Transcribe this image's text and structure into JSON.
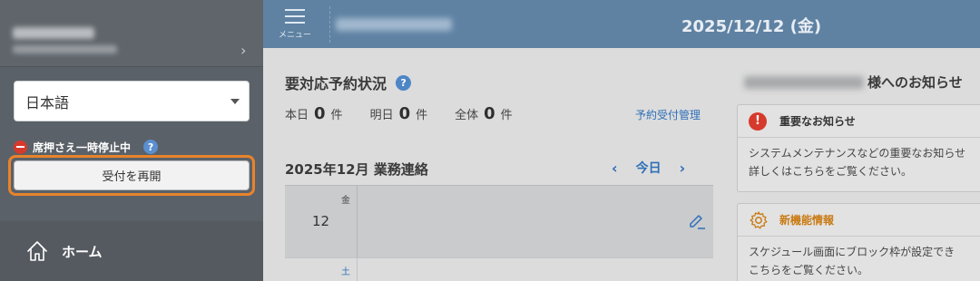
{
  "sidebar": {
    "account_chevron": "›",
    "language": {
      "selected": "日本語"
    },
    "pause_status": "席押さえ一時停止中",
    "help_glyph": "?",
    "resume_button": "受付を再開",
    "nav": {
      "home": "ホーム"
    }
  },
  "header": {
    "menu_label": "メニュー",
    "date": "2025/12/12 (金)"
  },
  "reservation": {
    "title": "要対応予約状況",
    "help_glyph": "?",
    "counts": [
      {
        "label": "本日",
        "value": "0",
        "unit": "件"
      },
      {
        "label": "明日",
        "value": "0",
        "unit": "件"
      },
      {
        "label": "全体",
        "value": "0",
        "unit": "件"
      }
    ],
    "manage_link": "予約受付管理"
  },
  "contact": {
    "title": "2025年12月 業務連絡",
    "prev": "‹",
    "today": "今日",
    "next": "›",
    "rows": [
      {
        "weekday": "金",
        "day": "12"
      },
      {
        "weekday": "土",
        "day": ""
      }
    ]
  },
  "notices": {
    "title_suffix": "様へのお知らせ",
    "important": {
      "icon": "!",
      "title": "重要なお知らせ",
      "body_line1": "システムメンテナンスなどの重要なお知らせ",
      "body_line2": "詳しくはこちらをご覧ください。"
    },
    "new_features": {
      "title": "新機能情報",
      "body_line1": "スケジュール画面にブロック枠が設定でき",
      "body_line2": "こちらをご覧ください。"
    }
  },
  "colors": {
    "sidebar_bg": "#5b6168",
    "header_bg": "#5f82a3",
    "accent_orange": "#e8832b",
    "link_blue": "#2e6fb8",
    "alert_red": "#d63a2c"
  }
}
